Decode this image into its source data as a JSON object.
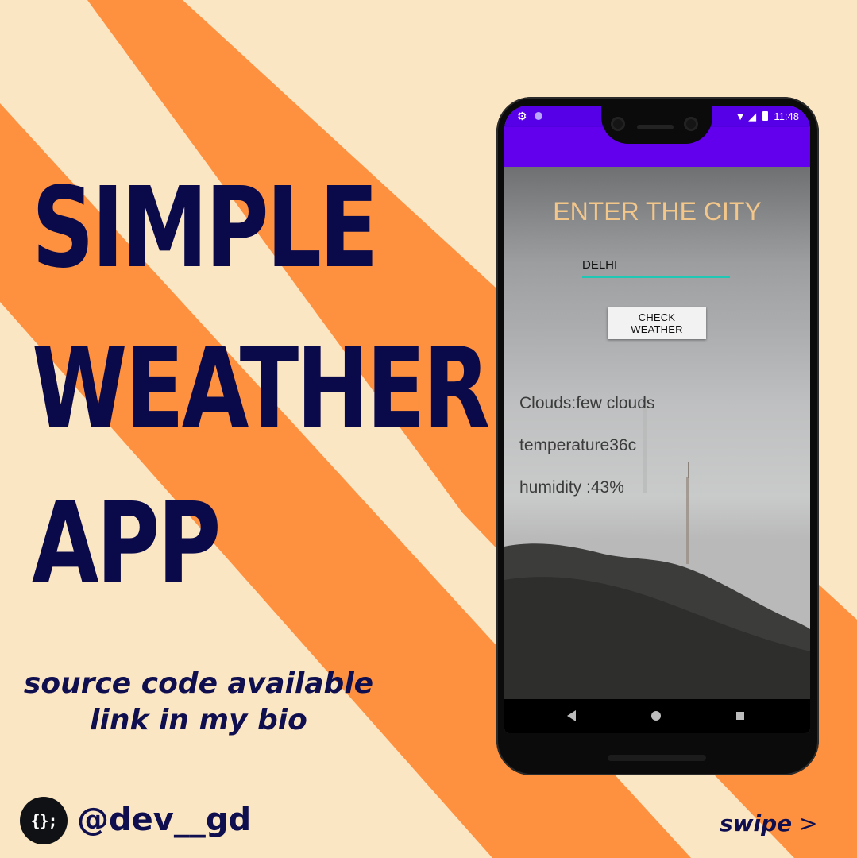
{
  "poster": {
    "title_lines": [
      "SIMPLE",
      "WEATHER",
      "APP"
    ],
    "source_lines": [
      "source code available",
      "link in my bio"
    ],
    "handle": "@dev__gd",
    "avatar_text": "{};",
    "swipe_word": "swipe",
    "swipe_arrow": ">",
    "colors": {
      "background": "#fbe6c4",
      "stripe": "#fe9140",
      "title": "#0a0a4a"
    }
  },
  "phone": {
    "status_time": "11:48",
    "status_icons": [
      "gear-icon",
      "circle-icon",
      "wifi-icon",
      "signal-icon",
      "battery-icon"
    ],
    "app_bar_color": "#6200ee",
    "screen": {
      "title": "ENTER THE CITY",
      "city_value": "DELHI",
      "button_label": "CHECK WEATHER",
      "clouds": "Clouds:few clouds",
      "temperature": "temperature36c",
      "humidity": "humidity :43%"
    },
    "nav_icons": [
      "back-icon",
      "home-icon",
      "recents-icon"
    ]
  }
}
